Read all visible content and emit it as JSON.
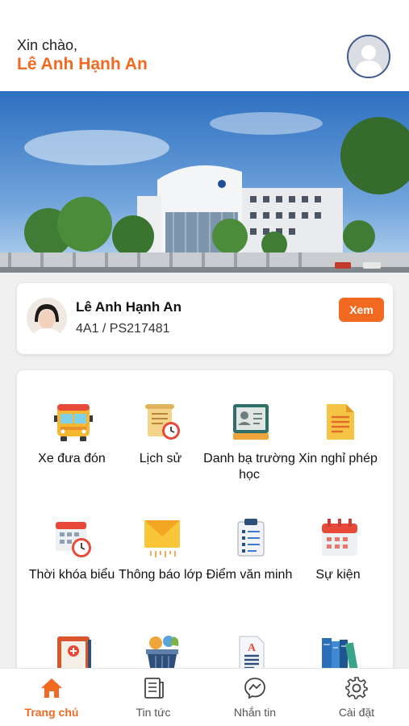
{
  "header": {
    "greeting": "Xin chào,",
    "user_name": "Lê Anh Hạnh An",
    "avatar_icon": "user-avatar-icon"
  },
  "banner": {
    "image": "school-building-photo"
  },
  "student": {
    "name": "Lê Anh Hạnh An",
    "class_id": "4A1 / PS217481",
    "view_label": "Xem"
  },
  "menu": {
    "items": [
      {
        "label": "Xe đưa đón",
        "icon": "school-bus-icon"
      },
      {
        "label": "Lịch sử",
        "icon": "history-scroll-icon"
      },
      {
        "label": "Danh bạ trường học",
        "icon": "contact-card-icon"
      },
      {
        "label": "Xin nghỉ phép",
        "icon": "leave-request-document-icon"
      },
      {
        "label": "Thời khóa biểu",
        "icon": "timetable-calendar-icon"
      },
      {
        "label": "Thông báo lớp",
        "icon": "envelope-icon"
      },
      {
        "label": "Điểm văn minh",
        "icon": "clipboard-list-icon"
      },
      {
        "label": "Sự kiện",
        "icon": "event-calendar-icon"
      },
      {
        "label": "",
        "icon": "medical-clipboard-icon"
      },
      {
        "label": "",
        "icon": "food-basket-icon"
      },
      {
        "label": "",
        "icon": "document-a-icon"
      },
      {
        "label": "",
        "icon": "books-icon"
      }
    ]
  },
  "nav": {
    "items": [
      {
        "label": "Trang chủ",
        "icon": "home-icon",
        "active": true
      },
      {
        "label": "Tin tức",
        "icon": "news-icon",
        "active": false
      },
      {
        "label": "Nhắn tin",
        "icon": "messenger-icon",
        "active": false
      },
      {
        "label": "Cài đặt",
        "icon": "gear-icon",
        "active": false
      }
    ]
  },
  "colors": {
    "accent": "#f26a21",
    "active_nav": "#f26a21"
  }
}
